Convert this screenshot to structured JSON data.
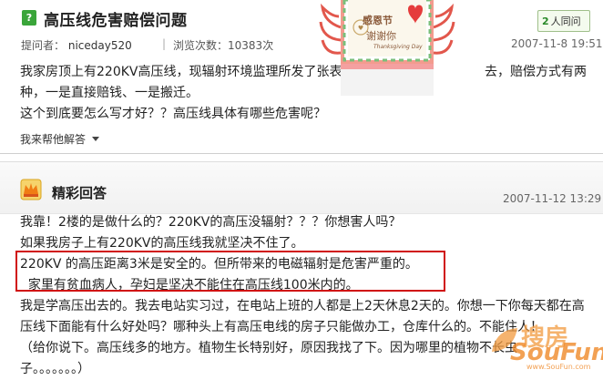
{
  "question": {
    "title": "高压线危害赔偿问题",
    "same_question_count": "2",
    "same_question_label": "人同问",
    "asker_label": "提问者：",
    "asker_name": "niceday520",
    "separator": "|",
    "views_label": "浏览次数：",
    "views_count": "10383次",
    "time": "2007-11-8 19:51",
    "body_lines": [
      "我家房顶上有220KV高压线，现辐射环境监理所发了张表",
      "去，赔偿方式有两",
      "种，一是直接赔钱、一是搬迁。",
      "这个到底要怎么写才好？？高压线具体有哪些危害呢？"
    ],
    "help_label": "我来帮他解答"
  },
  "card": {
    "line1": "感恩节",
    "line2": "谢谢你",
    "line3": "Thanksgiving Day"
  },
  "answer": {
    "heading": "精彩回答",
    "time": "2007-11-12 13:29",
    "lines": [
      "我靠！2楼的是做什么的？220KV的高压没辐射？？？你想害人吗？",
      "如果我房子上有220KV的高压线我就坚决不住了。",
      "220KV 的高压距离3米是安全的。但所带来的电磁辐射是危害严重的。",
      "  家里有贫血病人，孕妇是坚决不能住在高压线100米内的。",
      "我是学高压出去的。我去电站实习过，在电站上班的人都是上2天休息2天的。你想一下你每天都在高",
      "压线下面能有什么好处吗？哪种头上有高压电线的房子只能做办工，仓库什么的。不能住人！",
      "（给你说下。高压线多的地方。植物生长特别好，原因我找了下。因为哪里的植物不长虫",
      "子。。。。。。。）"
    ]
  },
  "watermark": {
    "cn": "搜房",
    "en": "SouFun",
    "url": "www.SouFun.com"
  },
  "colors": {
    "accent_green": "#3aa53a",
    "highlight_red": "#d01010",
    "watermark_orange": "#f08a2a"
  }
}
